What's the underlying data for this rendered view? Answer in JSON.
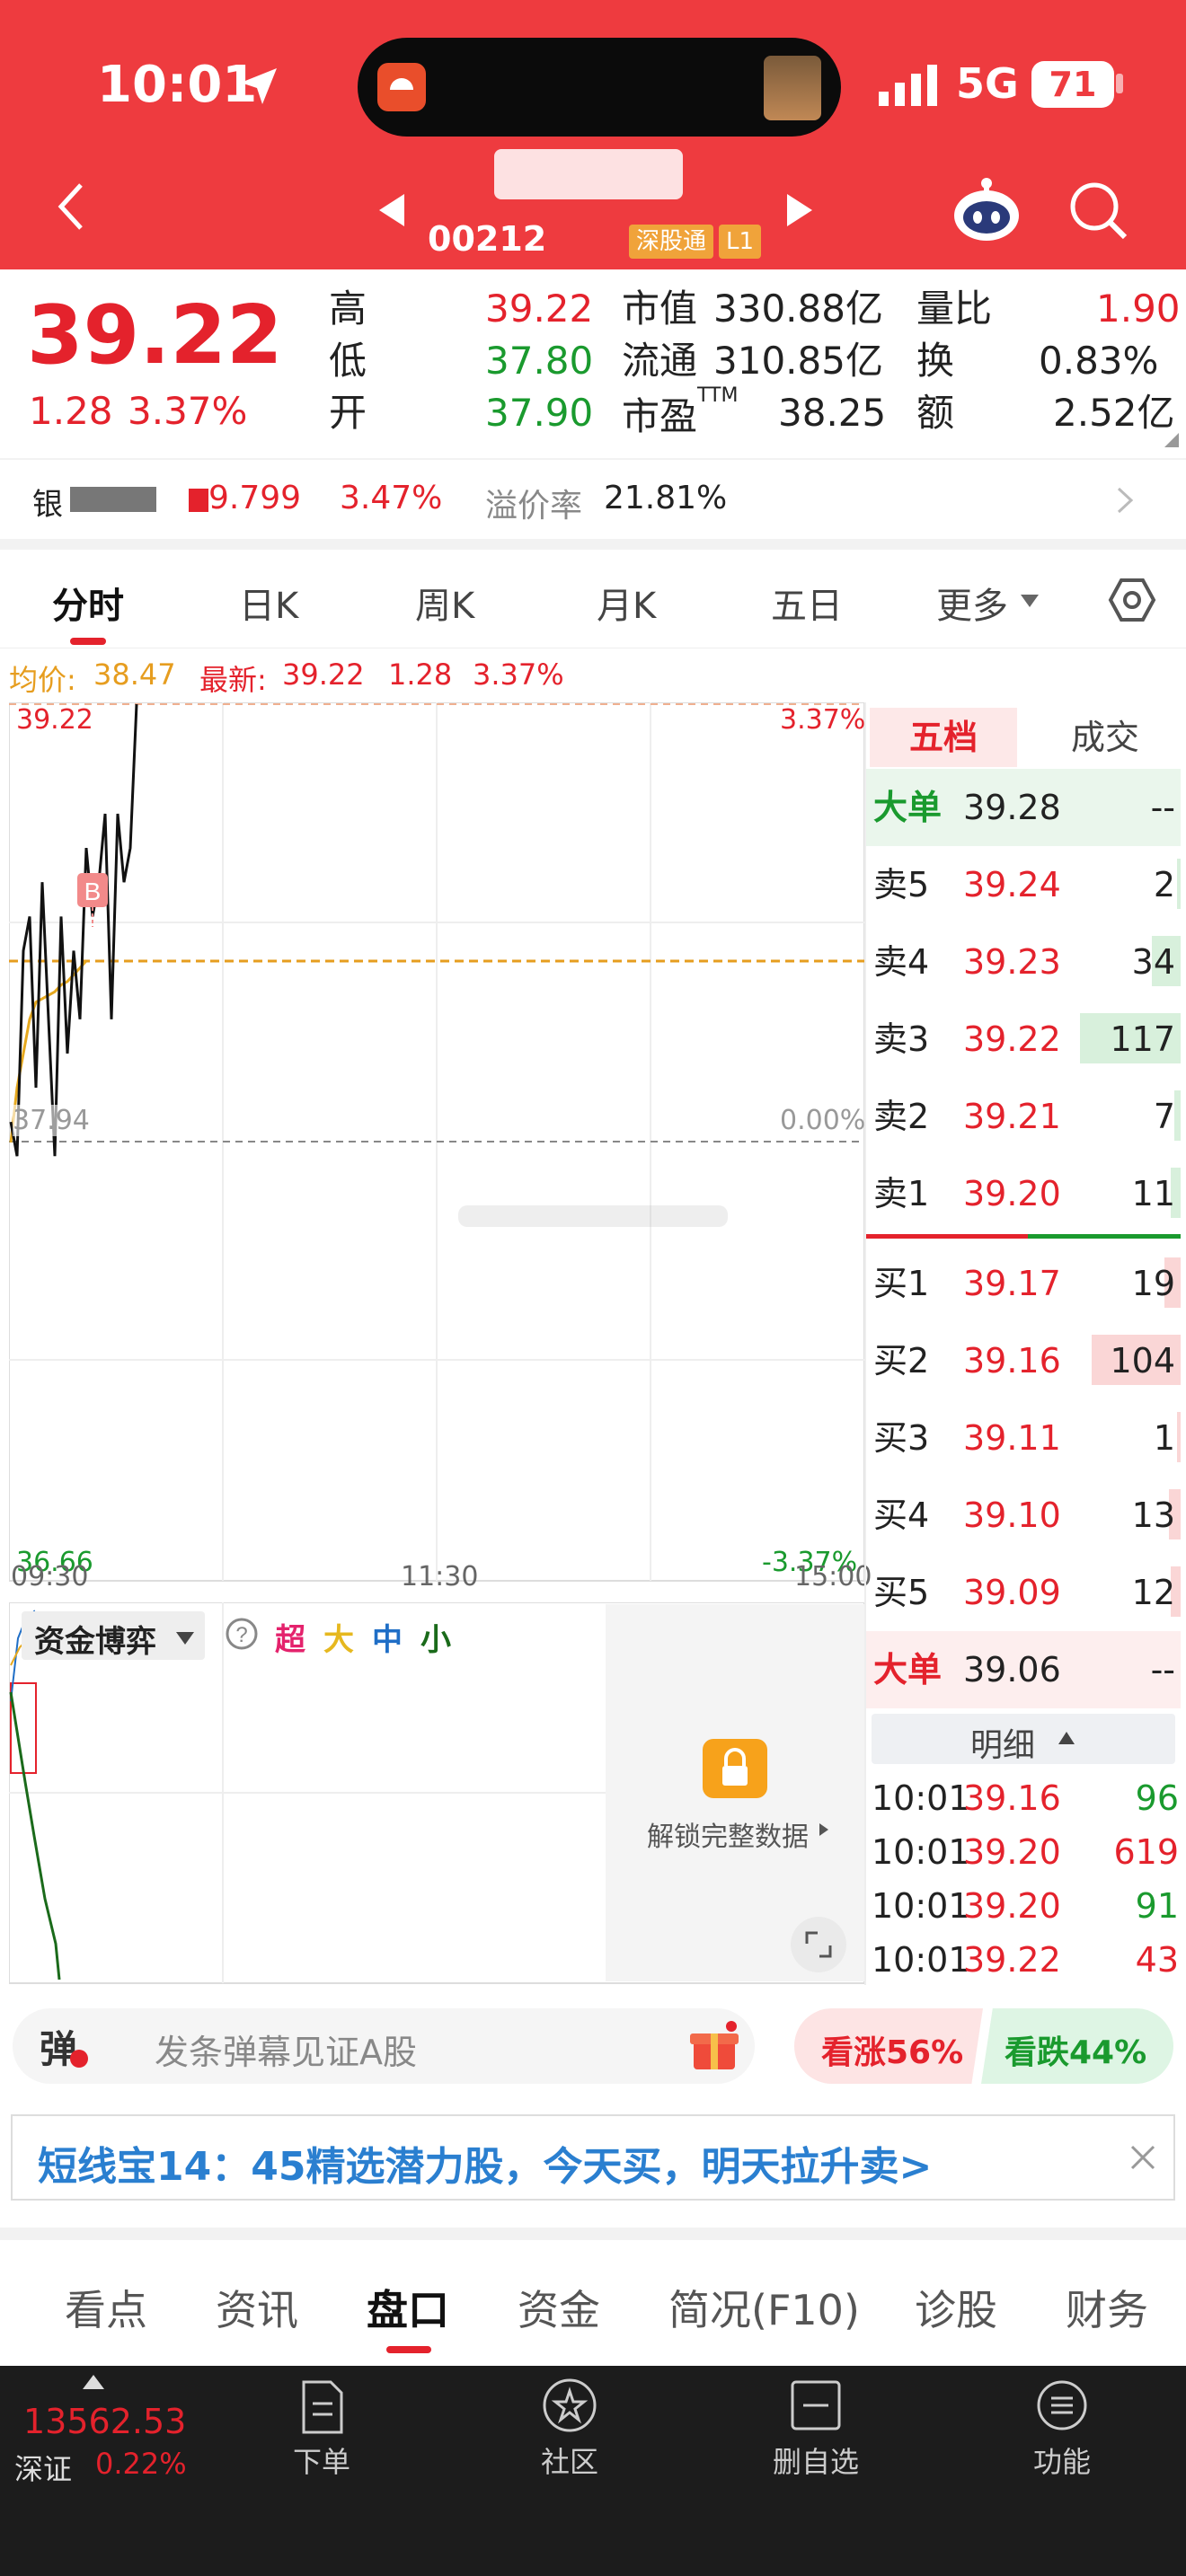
{
  "status": {
    "time": "10:01",
    "network": "5G",
    "battery": "71"
  },
  "header": {
    "code": "00212",
    "tag1": "深股通",
    "tag2": "L1"
  },
  "quote": {
    "price": "39.22",
    "change": "1.28",
    "change_pct": "3.37%",
    "high_label": "高",
    "high": "39.22",
    "low_label": "低",
    "low": "37.80",
    "open_label": "开",
    "open": "37.90",
    "mcap_label": "市值",
    "mcap": "330.88亿",
    "float_label": "流通",
    "float": "310.85亿",
    "pe_label": "市盈",
    "pe_sup": "TTM",
    "pe": "38.25",
    "vr_label": "量比",
    "vr": "1.90",
    "turnover_label": "换",
    "turnover": "0.83%",
    "amount_label": "额",
    "amount": "2.52亿"
  },
  "etf": {
    "name": "银",
    "price": "9.799",
    "pct": "3.47%",
    "premium_label": "溢价率",
    "premium": "21.81%"
  },
  "tabs": [
    "分时",
    "日K",
    "周K",
    "月K",
    "五日",
    "更多"
  ],
  "chart_info": {
    "avg_label": "均价:",
    "avg": "38.47",
    "latest_label": "最新:",
    "latest": "39.22",
    "chg": "1.28",
    "pct": "3.37%"
  },
  "chart_data": {
    "type": "line",
    "ylim": [
      36.66,
      39.22
    ],
    "y_ticks_left": [
      "39.22",
      "37.94",
      "36.66"
    ],
    "y_ticks_right": [
      "3.37%",
      "0.00%",
      "-3.37%"
    ],
    "x_ticks": [
      "09:30",
      "11:30",
      "15:00"
    ],
    "series": [
      {
        "values": [
          38.0,
          37.9,
          38.5,
          38.6,
          38.1,
          38.7,
          38.3,
          37.9,
          38.6,
          38.2,
          38.5,
          38.3,
          38.8,
          38.6,
          38.7,
          38.9,
          38.3,
          38.9,
          38.7,
          38.8,
          39.22
        ]
      },
      {
        "values": [
          37.94,
          38.1,
          38.2,
          38.3,
          38.35,
          38.36,
          38.37,
          38.38,
          38.4,
          38.41,
          38.43,
          38.45,
          38.47
        ]
      }
    ],
    "marker": "B"
  },
  "orderbook": {
    "tab1": "五档",
    "tab2": "成交",
    "big_sell": {
      "label": "大单",
      "price": "39.28",
      "vol": "--"
    },
    "asks": [
      {
        "label": "卖5",
        "price": "39.24",
        "vol": "2",
        "fill": 0.02
      },
      {
        "label": "卖4",
        "price": "39.23",
        "vol": "34",
        "fill": 0.18
      },
      {
        "label": "卖3",
        "price": "39.22",
        "vol": "117",
        "fill": 0.62
      },
      {
        "label": "卖2",
        "price": "39.21",
        "vol": "7",
        "fill": 0.04
      },
      {
        "label": "卖1",
        "price": "39.20",
        "vol": "11",
        "fill": 0.06
      }
    ],
    "bids": [
      {
        "label": "买1",
        "price": "39.17",
        "vol": "19",
        "fill": 0.1
      },
      {
        "label": "买2",
        "price": "39.16",
        "vol": "104",
        "fill": 0.55
      },
      {
        "label": "买3",
        "price": "39.11",
        "vol": "1",
        "fill": 0.01
      },
      {
        "label": "买4",
        "price": "39.10",
        "vol": "13",
        "fill": 0.07
      },
      {
        "label": "买5",
        "price": "39.09",
        "vol": "12",
        "fill": 0.06
      }
    ],
    "big_buy": {
      "label": "大单",
      "price": "39.06",
      "vol": "--"
    },
    "detail_label": "明细",
    "ticks": [
      {
        "time": "10:01",
        "price": "39.16",
        "vol": "96",
        "color": "#1a9a2e"
      },
      {
        "time": "10:01",
        "price": "39.20",
        "vol": "619",
        "color": "#e4222c"
      },
      {
        "time": "10:01",
        "price": "39.20",
        "vol": "91",
        "color": "#1a9a2e"
      },
      {
        "time": "10:01",
        "price": "39.22",
        "vol": "43",
        "color": "#e4222c"
      }
    ]
  },
  "fund": {
    "dropdown": "资金博弈",
    "super": "超",
    "large": "大",
    "mid": "中",
    "small": "小",
    "unlock": "解锁完整数据"
  },
  "barrage": {
    "badge": "弹",
    "placeholder": "发条弹幕见证A股",
    "up": "看涨56%",
    "down": "看跌44%",
    "up_ratio": 0.56
  },
  "ad": {
    "text": "短线宝14：45精选潜力股，今天买，明天拉升卖>"
  },
  "bottom_tabs": [
    "看点",
    "资讯",
    "盘口",
    "资金",
    "简况(F10)",
    "诊股",
    "财务"
  ],
  "index": {
    "value": "13562.53",
    "name": "深证",
    "pct": "0.22%"
  },
  "dock": [
    "下单",
    "社区",
    "删自选",
    "功能"
  ]
}
